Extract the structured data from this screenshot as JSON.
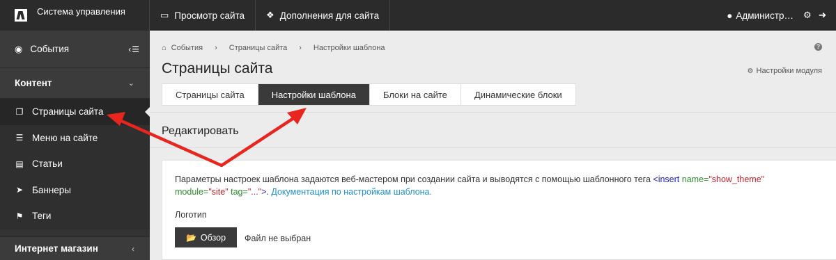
{
  "topbar": {
    "brand": "Система управления",
    "nav": [
      {
        "label": "Просмотр сайта",
        "icon": "monitor-icon"
      },
      {
        "label": "Дополнения для сайта",
        "icon": "cubes-icon"
      }
    ],
    "user": "Администр…",
    "icons": [
      "user-icon",
      "gear-icon",
      "logout-icon"
    ]
  },
  "sidebar": {
    "events": "События",
    "section": "Контент",
    "items": [
      {
        "label": "Страницы сайта",
        "icon": "pages-icon",
        "active": true
      },
      {
        "label": "Меню на сайте",
        "icon": "list-icon"
      },
      {
        "label": "Статьи",
        "icon": "article-icon"
      },
      {
        "label": "Баннеры",
        "icon": "rocket-icon"
      },
      {
        "label": "Теги",
        "icon": "tag-icon"
      }
    ],
    "section2": "Интернет магазин"
  },
  "breadcrumb": [
    "События",
    "Страницы сайта",
    "Настройки шаблона"
  ],
  "page_title": "Страницы сайта",
  "module_settings": "Настройки модуля",
  "tabs": [
    {
      "label": "Страницы сайта",
      "active": false
    },
    {
      "label": "Настройки шаблона",
      "active": true
    },
    {
      "label": "Блоки на сайте",
      "active": false
    },
    {
      "label": "Динамические блоки",
      "active": false
    }
  ],
  "panel": {
    "heading": "Редактировать",
    "desc_text": "Параметры настроек шаблона задаются веб-мастером при создании сайта и выводятся с помощью шаблонного тега ",
    "tag_open": "<insert",
    "tag_attr1": "name=",
    "tag_val1": "\"show_theme\"",
    "tag_attr2": "module=",
    "tag_val2": "\"site\"",
    "tag_attr3": "tag=",
    "tag_val3": "\"...\"",
    "tag_close": ">",
    "doc_link": "Документация по настройкам шаблона.",
    "logo_label": "Логотип",
    "browse_button": "Обзор",
    "file_status": "Файл не выбран"
  },
  "colors": {
    "topbar": "#2b2b2b",
    "sidebar": "#333333",
    "active_tab": "#3a3a3a",
    "arrow": "#e8251f",
    "link": "#1e90c8"
  }
}
